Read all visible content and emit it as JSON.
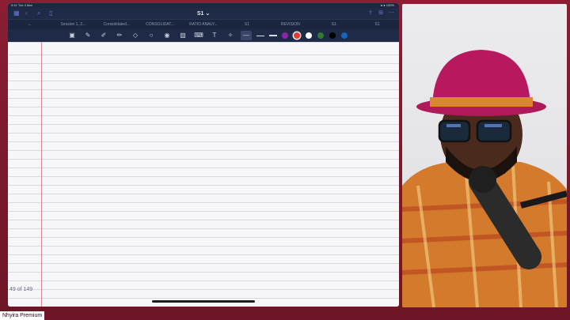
{
  "app": {
    "document_title": "S1",
    "status_left": "9:41  Tue 4 Mar",
    "status_right": "● ● 100%"
  },
  "tabs": [
    {
      "label": "..."
    },
    {
      "label": "Session 1, 2..."
    },
    {
      "label": "Consolidated..."
    },
    {
      "label": "CONSOLIDAT..."
    },
    {
      "label": "RATIO ANALY..."
    },
    {
      "label": "S1"
    },
    {
      "label": "REVISION"
    },
    {
      "label": "S1"
    },
    {
      "label": "S1"
    }
  ],
  "toolbar": {
    "tools": [
      "image-icon",
      "lasso-icon",
      "pen-icon",
      "highlighter-icon",
      "eraser-icon",
      "shape-icon",
      "sticker-icon",
      "photo-icon",
      "keyboard-icon",
      "text-icon",
      "laser-icon"
    ],
    "colors": [
      "#8e24aa",
      "#e53935",
      "#ffffff",
      "#2e7d32",
      "#000000",
      "#1565c0"
    ],
    "selected_color": "#e53935"
  },
  "page": {
    "page_count": "49 of 149"
  },
  "colors": {
    "background": "#7a1a2c",
    "toolbar": "#1f2a46",
    "margin_line": "#d88a96"
  },
  "caption": {
    "text": "Nhyira Premium"
  }
}
